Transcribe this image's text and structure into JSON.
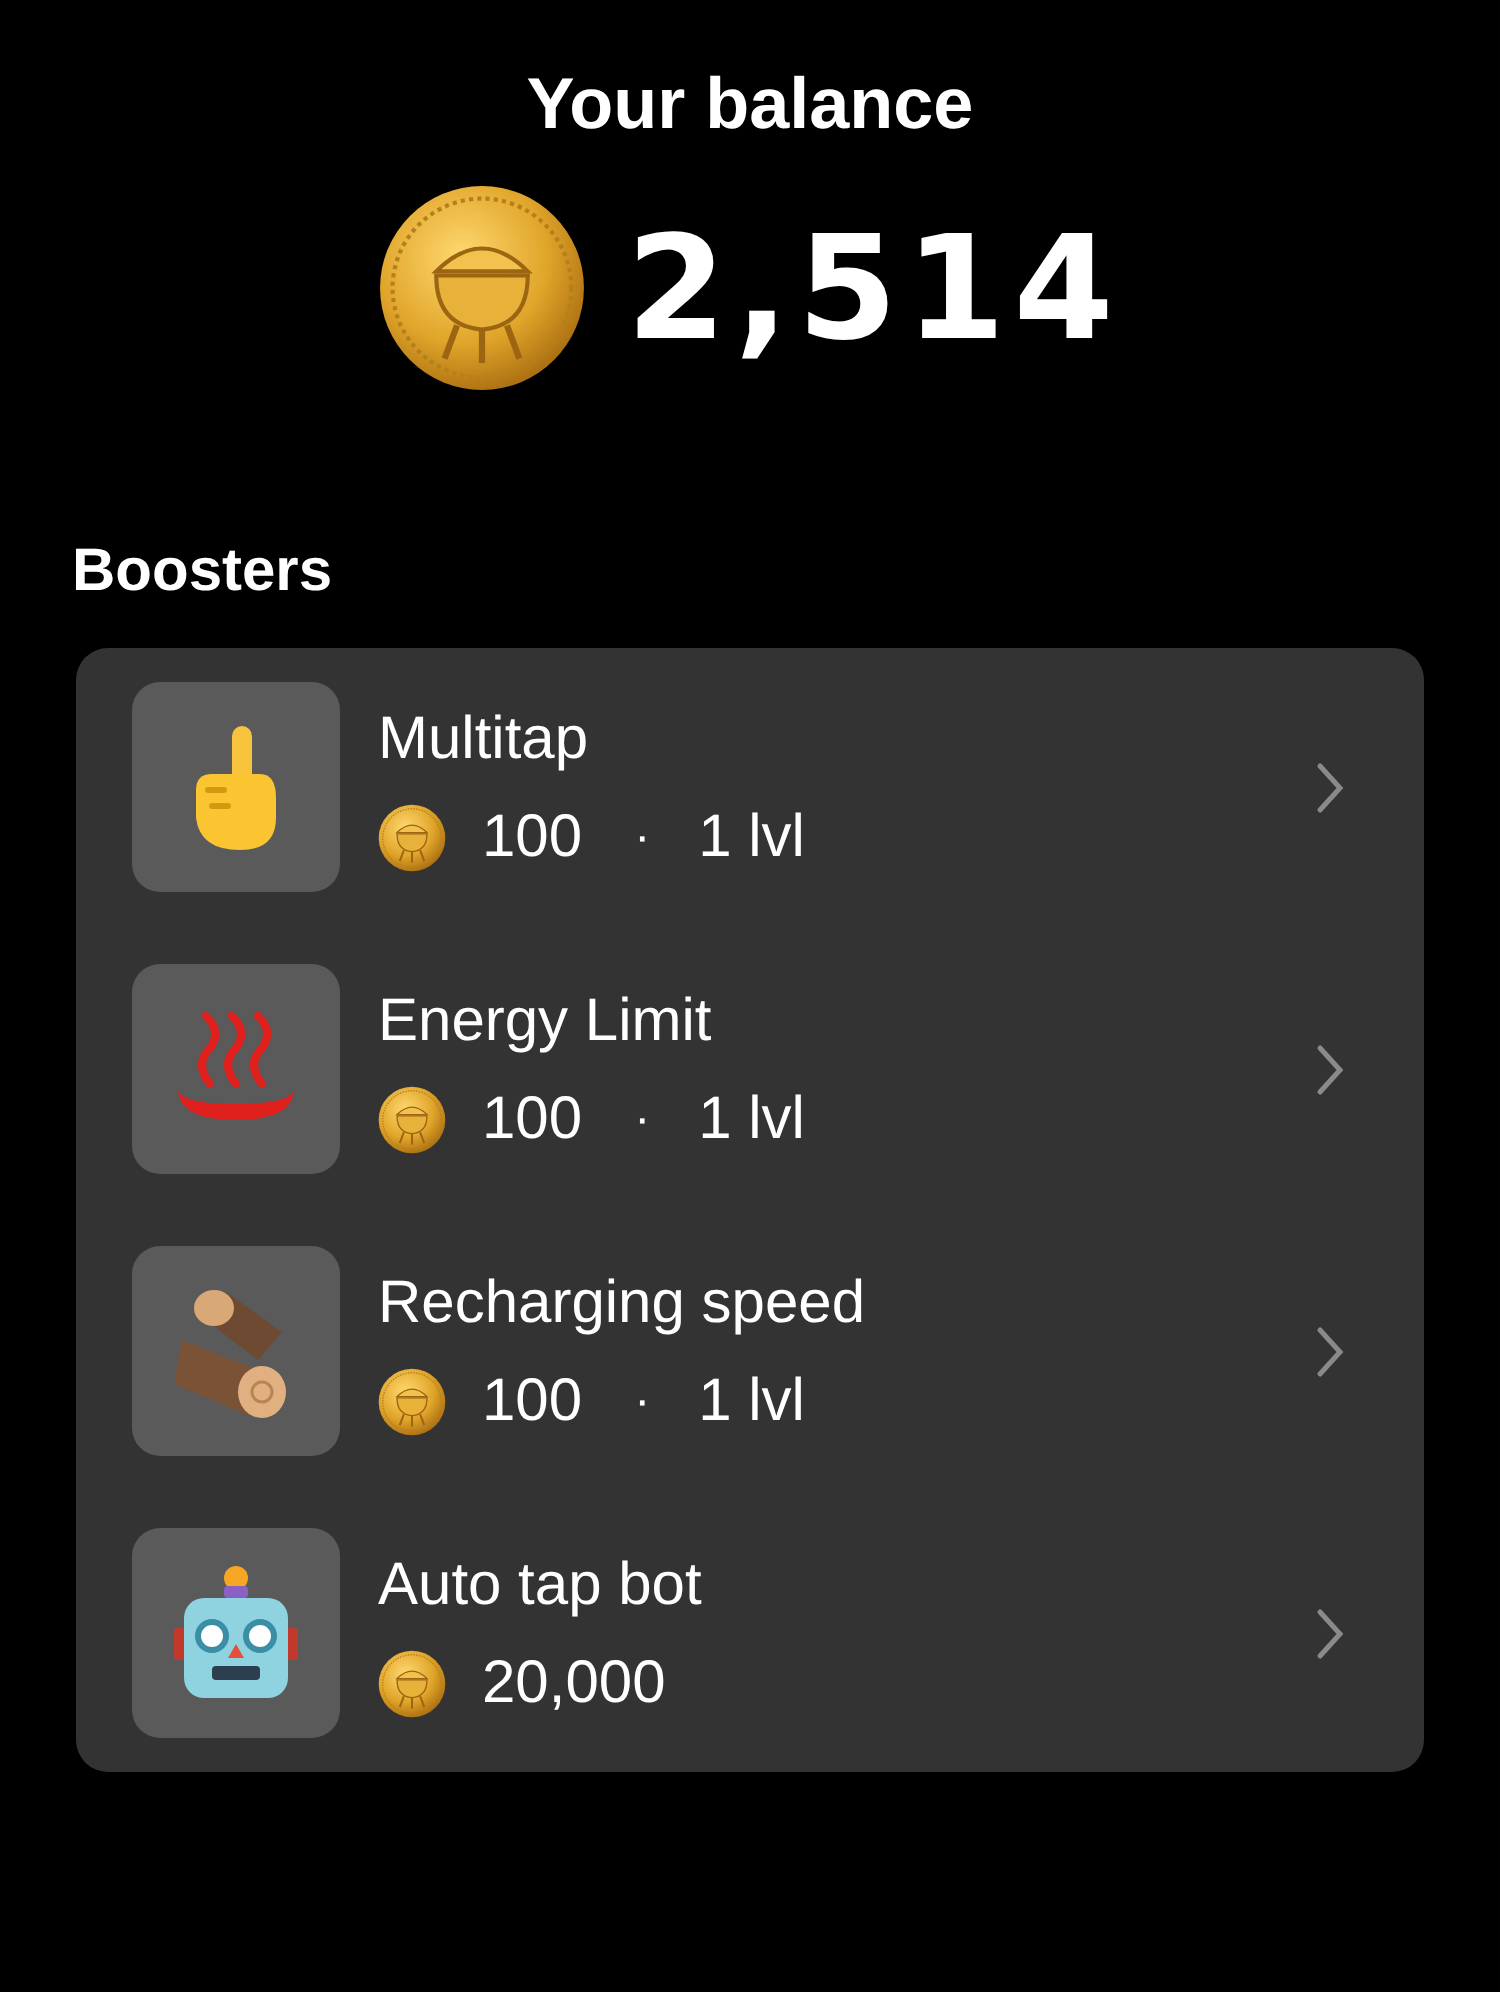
{
  "header": {
    "title": "Your balance",
    "balance": "2,514"
  },
  "section": {
    "title": "Boosters"
  },
  "boosters": [
    {
      "kind": "finger",
      "name": "Multitap",
      "price": "100",
      "separator": "·",
      "level": "1 lvl"
    },
    {
      "kind": "steam",
      "name": "Energy Limit",
      "price": "100",
      "separator": "·",
      "level": "1 lvl"
    },
    {
      "kind": "logs",
      "name": "Recharging speed",
      "price": "100",
      "separator": "·",
      "level": "1 lvl"
    },
    {
      "kind": "robot",
      "name": "Auto tap bot",
      "price": "20,000"
    }
  ]
}
